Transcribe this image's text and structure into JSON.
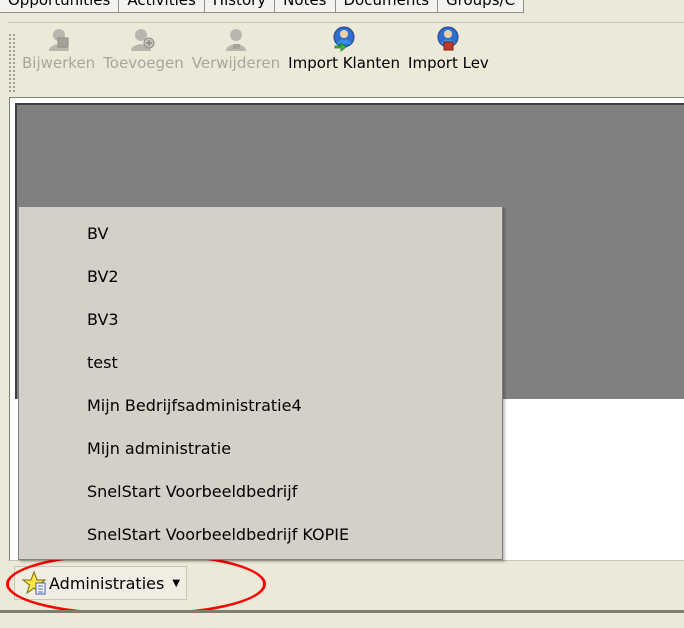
{
  "tabs": [
    "Opportunities",
    "Activities",
    "History",
    "Notes",
    "Documents",
    "Groups/C"
  ],
  "toolbar": {
    "buttons": [
      {
        "label": "Bijwerken",
        "icon": "user-edit-icon",
        "enabled": false
      },
      {
        "label": "Toevoegen",
        "icon": "user-add-icon",
        "enabled": false
      },
      {
        "label": "Verwijderen",
        "icon": "user-delete-icon",
        "enabled": false
      },
      {
        "label": "Import Klanten",
        "icon": "import-customers-icon",
        "enabled": true
      },
      {
        "label": "Import Lev",
        "icon": "import-suppliers-icon",
        "enabled": true
      }
    ]
  },
  "menu": {
    "items": [
      "BV",
      "BV2",
      "BV3",
      "test",
      "Mijn Bedrijfsadministratie4",
      "Mijn administratie",
      "SnelStart Voorbeeldbedrijf",
      "SnelStart Voorbeeldbedrijf KOPIE"
    ]
  },
  "status_bar": {
    "administraties_label": "Administraties",
    "icon": "star-icon"
  },
  "colors": {
    "panel_gray": "#808080",
    "menu_bg": "#d4d0c8",
    "annotation": "#ff0000"
  }
}
